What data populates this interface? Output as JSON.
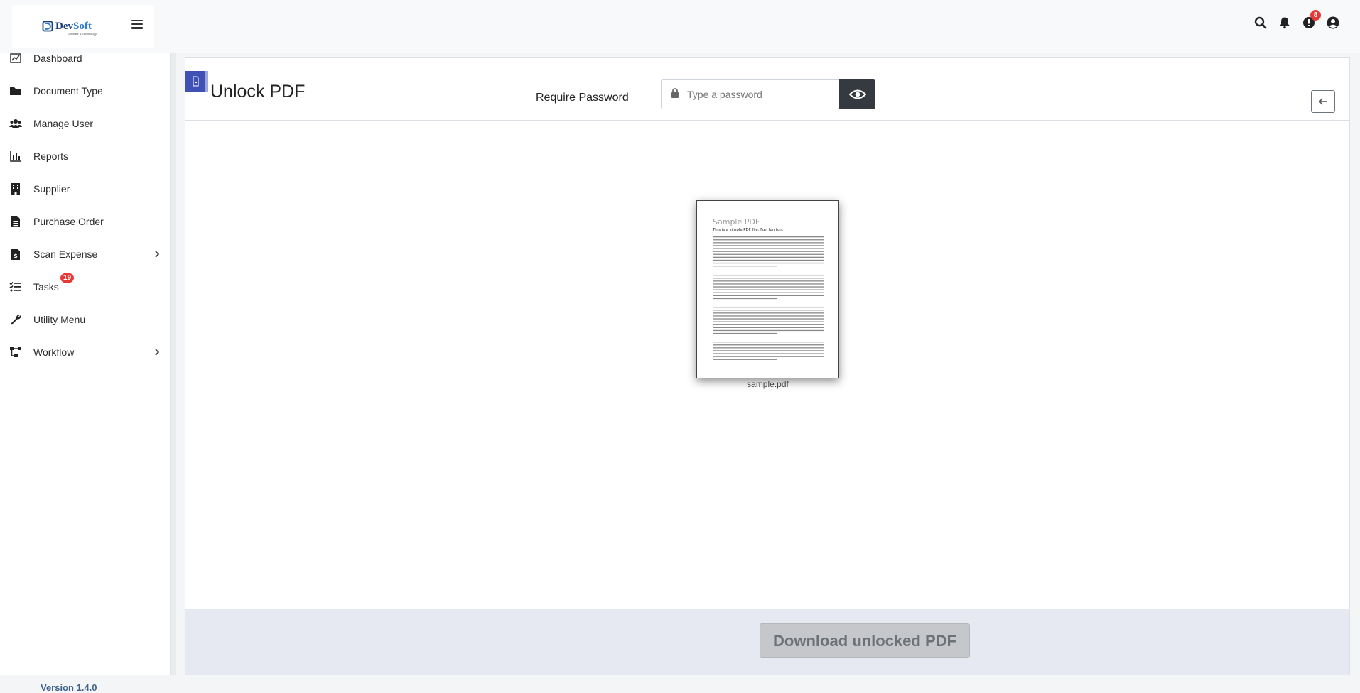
{
  "app": {
    "logo_text_a": "Dev",
    "logo_text_b": "Soft",
    "logo_tagline": "Software & Technology"
  },
  "header": {
    "notifications_badge": "8"
  },
  "sidebar": {
    "items": [
      {
        "label": "Dashboard",
        "icon": "dashboard-icon"
      },
      {
        "label": "Document Type",
        "icon": "folder-icon"
      },
      {
        "label": "Manage User",
        "icon": "users-icon"
      },
      {
        "label": "Reports",
        "icon": "chart-icon"
      },
      {
        "label": "Supplier",
        "icon": "building-icon"
      },
      {
        "label": "Purchase Order",
        "icon": "file-icon"
      },
      {
        "label": "Scan Expense",
        "icon": "receipt-icon",
        "has_submenu": true
      },
      {
        "label": "Tasks",
        "icon": "tasks-icon",
        "badge": "19"
      },
      {
        "label": "Utility Menu",
        "icon": "wrench-icon"
      },
      {
        "label": "Workflow",
        "icon": "workflow-icon",
        "has_submenu": true
      }
    ],
    "version": "Version 1.4.0"
  },
  "main": {
    "title": "Unlock PDF",
    "password_label": "Require Password",
    "password_placeholder": "Type a password",
    "file_name": "sample.pdf",
    "download_label": "Download unlocked PDF"
  },
  "preview_doc": {
    "heading": "Sample PDF",
    "subheading": "This is a simple PDF file. Fun fun fun."
  },
  "colors": {
    "accent": "#3f51b5",
    "badge": "#e53935",
    "eye_button": "#343a40",
    "download_bg": "#c5c7ca",
    "footer_bg": "#e6e9f2"
  }
}
